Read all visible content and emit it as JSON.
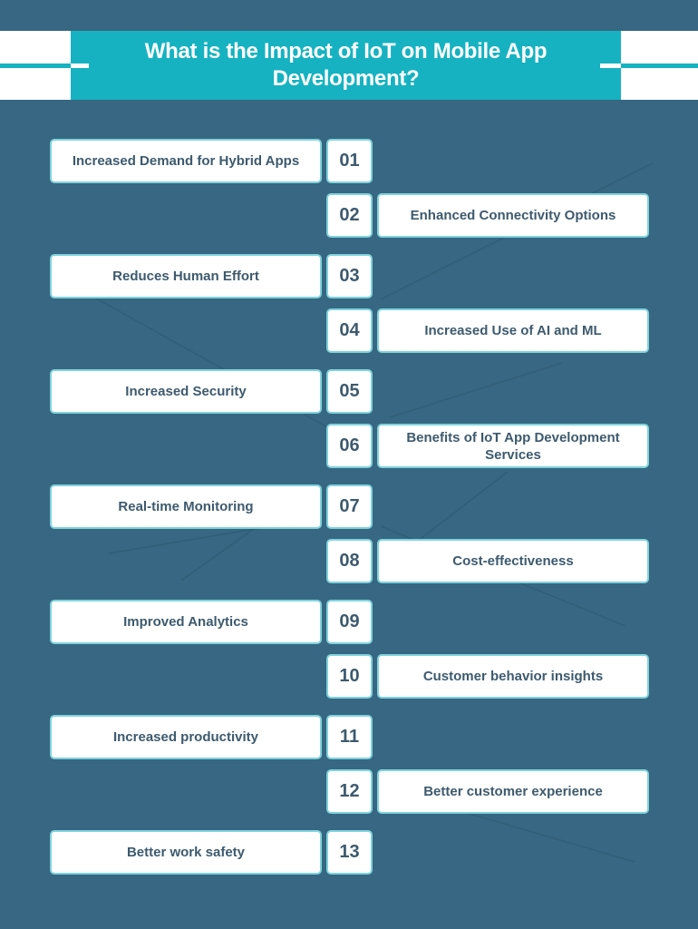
{
  "header": {
    "title": "What is the Impact of IoT on Mobile App Development?"
  },
  "colors": {
    "background": "#376782",
    "accent": "#16b2c1",
    "box_fill": "#ffffff",
    "box_border": "#7fd3dc",
    "box_text": "#3d5a6e"
  },
  "items": [
    {
      "number": "01",
      "label": "Increased Demand for Hybrid Apps",
      "side": "left"
    },
    {
      "number": "02",
      "label": "Enhanced Connectivity Options",
      "side": "right"
    },
    {
      "number": "03",
      "label": "Reduces Human Effort",
      "side": "left"
    },
    {
      "number": "04",
      "label": "Increased Use of AI and ML",
      "side": "right"
    },
    {
      "number": "05",
      "label": "Increased Security",
      "side": "left"
    },
    {
      "number": "06",
      "label": "Benefits of IoT App Development Services",
      "side": "right"
    },
    {
      "number": "07",
      "label": "Real-time Monitoring",
      "side": "left"
    },
    {
      "number": "08",
      "label": "Cost-effectiveness",
      "side": "right"
    },
    {
      "number": "09",
      "label": "Improved Analytics",
      "side": "left"
    },
    {
      "number": "10",
      "label": "Customer behavior insights",
      "side": "right"
    },
    {
      "number": "11",
      "label": "Increased productivity",
      "side": "left"
    },
    {
      "number": "12",
      "label": "Better customer experience",
      "side": "right"
    },
    {
      "number": "13",
      "label": "Better work safety",
      "side": "left"
    }
  ]
}
